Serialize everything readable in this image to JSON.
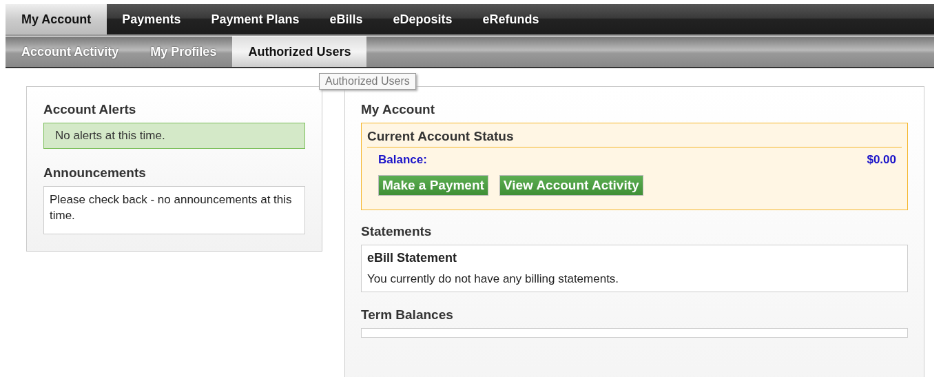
{
  "main_tabs": [
    {
      "label": "My Account",
      "selected": true
    },
    {
      "label": "Payments",
      "selected": false
    },
    {
      "label": "Payment Plans",
      "selected": false
    },
    {
      "label": "eBills",
      "selected": false
    },
    {
      "label": "eDeposits",
      "selected": false
    },
    {
      "label": "eRefunds",
      "selected": false
    }
  ],
  "sub_tabs": [
    {
      "label": "Account Activity",
      "selected": false
    },
    {
      "label": "My Profiles",
      "selected": false
    },
    {
      "label": "Authorized Users",
      "selected": true
    }
  ],
  "tooltip": "Authorized Users",
  "alerts": {
    "title": "Account Alerts",
    "message": "No alerts at this time."
  },
  "announcements": {
    "title": "Announcements",
    "message": "Please check back - no announcements at this time."
  },
  "my_account": {
    "title": "My Account",
    "status": {
      "title": "Current Account Status",
      "balance_label": "Balance:",
      "balance_value": "$0.00",
      "buttons": [
        "Make a Payment",
        "View Account Activity"
      ]
    }
  },
  "statements": {
    "title": "Statements",
    "heading": "eBill Statement",
    "message": "You currently do not have any billing statements."
  },
  "term_balances": {
    "title": "Term Balances"
  }
}
